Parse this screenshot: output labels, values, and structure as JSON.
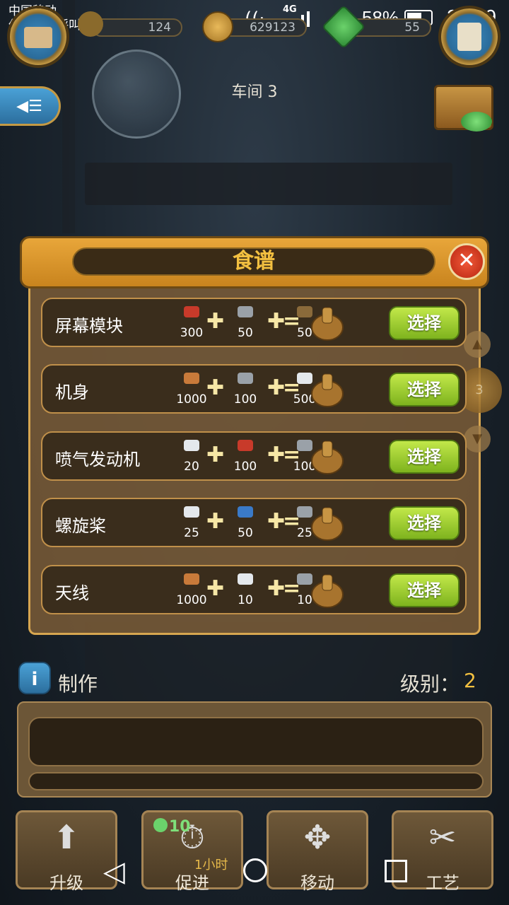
{
  "status_bar": {
    "carrier_line1": "中国移动",
    "carrier_line2": "仅限紧急呼叫",
    "network": "4G",
    "battery": "58%",
    "time": "22:29"
  },
  "hud": {
    "energy": "124",
    "coins": "629123",
    "gems": "55",
    "workshop_label": "车间",
    "workshop_number": "3"
  },
  "recipe_panel": {
    "title": "食谱",
    "close_symbol": "✕",
    "select_label": "选择",
    "current_page": "3",
    "recipes": [
      {
        "name": "屏幕模块",
        "ingredients": [
          {
            "qty": "300",
            "icon": "red-spool-icon",
            "color": "#c83a2a"
          },
          {
            "qty": "50",
            "icon": "silver-ingot-icon",
            "color": "#9aa1a8"
          },
          {
            "qty": "50",
            "icon": "battery-icon",
            "color": "#8a6a3a"
          }
        ],
        "product_icon": "screen-module-icon"
      },
      {
        "name": "机身",
        "ingredients": [
          {
            "qty": "1000",
            "icon": "screw-icon",
            "color": "#c87a3a"
          },
          {
            "qty": "100",
            "icon": "silver-ingot-icon",
            "color": "#9aa1a8"
          },
          {
            "qty": "500",
            "icon": "white-ingot-icon",
            "color": "#e4e8ec"
          }
        ],
        "product_icon": "fuselage-icon"
      },
      {
        "name": "喷气发动机",
        "ingredients": [
          {
            "qty": "20",
            "icon": "white-ingot-icon",
            "color": "#e4e8ec"
          },
          {
            "qty": "100",
            "icon": "red-spool-icon",
            "color": "#c83a2a"
          },
          {
            "qty": "100",
            "icon": "silver-ingot-icon",
            "color": "#9aa1a8"
          }
        ],
        "product_icon": "jet-engine-icon"
      },
      {
        "name": "螺旋桨",
        "ingredients": [
          {
            "qty": "25",
            "icon": "white-ingot-icon",
            "color": "#e4e8ec"
          },
          {
            "qty": "50",
            "icon": "blue-spool-icon",
            "color": "#3a7ac8"
          },
          {
            "qty": "25",
            "icon": "silver-ingot-icon",
            "color": "#9aa1a8"
          }
        ],
        "product_icon": "propeller-icon"
      },
      {
        "name": "天线",
        "ingredients": [
          {
            "qty": "1000",
            "icon": "screw-icon",
            "color": "#c87a3a"
          },
          {
            "qty": "10",
            "icon": "white-ingot-icon",
            "color": "#e4e8ec"
          },
          {
            "qty": "10",
            "icon": "silver-ingot-icon",
            "color": "#9aa1a8"
          }
        ],
        "product_icon": "antenna-icon"
      }
    ]
  },
  "crafting": {
    "label": "制作",
    "level_label": "级别：",
    "level": "2"
  },
  "bottom_buttons": {
    "upgrade": "升级",
    "boost": "促进",
    "boost_cost": "10",
    "boost_time": "1小时",
    "move": "移动",
    "craft": "工艺"
  }
}
